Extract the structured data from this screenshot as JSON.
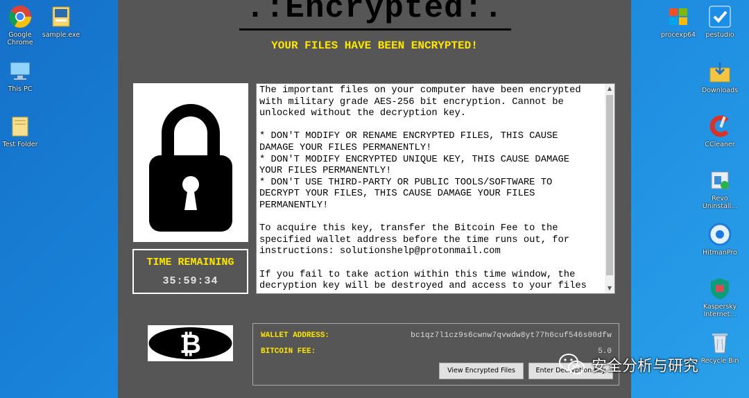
{
  "desktop_left": [
    {
      "label": "Google Chrome",
      "icon": "chrome-icon"
    },
    {
      "label": "sample.exe",
      "icon": "exe-file-icon"
    },
    {
      "label": "This PC",
      "icon": "this-pc-icon"
    },
    {
      "label": "Test Folder",
      "icon": "folder-icon"
    }
  ],
  "desktop_right": [
    {
      "label": "procexp64",
      "icon": "procexp-icon"
    },
    {
      "label": "pestudio",
      "icon": "pestudio-icon"
    },
    {
      "label": "Downloads",
      "icon": "downloads-icon"
    },
    {
      "label": "CCleaner",
      "icon": "ccleaner-icon"
    },
    {
      "label": "Revo Uninstall...",
      "icon": "revo-icon"
    },
    {
      "label": "HitmanPro",
      "icon": "hitmanpro-icon"
    },
    {
      "label": "Kaspersky Internet...",
      "icon": "kaspersky-icon"
    },
    {
      "label": "Recycle Bin",
      "icon": "recycle-bin-icon"
    }
  ],
  "ransom": {
    "title": ".:Encrypted:.",
    "subtitle": "YOUR FILES HAVE BEEN ENCRYPTED!",
    "timer_label": "TIME REMAINING",
    "timer_value": "35:59:34",
    "message": "The important files on your computer have been encrypted\nwith military grade AES-256 bit encryption. Cannot be\nunlocked without the decryption key.\n\n* DON'T MODIFY OR RENAME ENCRYPTED FILES, THIS CAUSE\nDAMAGE YOUR FILES PERMANENTLY!\n* DON'T MODIFY ENCRYPTED UNIQUE KEY, THIS CAUSE DAMAGE\nYOUR FILES PERMANENTLY!\n* DON'T USE THIRD-PARTY OR PUBLIC TOOLS/SOFTWARE TO\nDECRYPT YOUR FILES, THIS CAUSE DAMAGE YOUR FILES\nPERMANENTLY!\n\nTo acquire this key, transfer the Bitcoin Fee to the\nspecified wallet address before the time runs out, for\ninstructions: solutionshelp@protonmail.com\n\nIf you fail to take action within this time window, the\ndecryption key will be destroyed and access to your files",
    "wallet_label": "WALLET ADDRESS:",
    "wallet_address": "bc1qz7l1cz9s6cwnw7qvwdw8yt77h6cuf546s00dfw",
    "fee_label": "BITCOIN FEE:",
    "fee_value": "5.0",
    "view_button": "View Encrypted Files",
    "enter_button": "Enter Decryption Key"
  },
  "watermark": "安全分析与研究",
  "colors": {
    "accent_yellow": "#ffe600",
    "window_bg": "#565656",
    "desktop_blue": "#1a86dc"
  }
}
